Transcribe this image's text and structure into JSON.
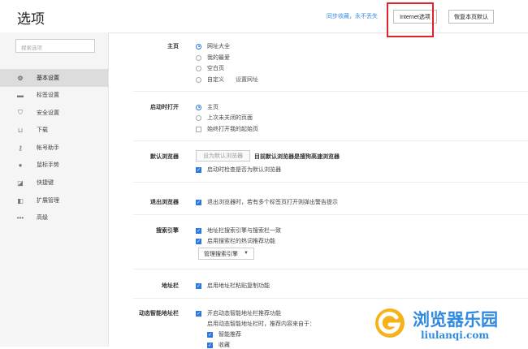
{
  "header": {
    "title": "选项",
    "sync_link": "同步收藏，永不丢失",
    "internet_options_label": "Internet选项",
    "restore_default_label": "恢复本页默认"
  },
  "sidebar": {
    "search_placeholder": "搜索选项",
    "items": [
      {
        "label": "基本设置",
        "icon": "gear-icon",
        "active": true
      },
      {
        "label": "标签设置",
        "icon": "tab-icon"
      },
      {
        "label": "安全设置",
        "icon": "shield-icon"
      },
      {
        "label": "下载",
        "icon": "download-icon"
      },
      {
        "label": "帐号助手",
        "icon": "key-icon"
      },
      {
        "label": "鼠标手势",
        "icon": "mouse-icon"
      },
      {
        "label": "快捷键",
        "icon": "shortcut-icon"
      },
      {
        "label": "扩展管理",
        "icon": "extension-icon"
      },
      {
        "label": "高级",
        "icon": "more-icon"
      }
    ]
  },
  "sections": {
    "homepage": {
      "label": "主页",
      "options": [
        "网址大全",
        "我的最爱",
        "空白页",
        "自定义"
      ],
      "selected": 0,
      "set_url_link": "设置网址"
    },
    "startup": {
      "label": "启动时打开",
      "options": [
        "主页",
        "上次未关闭的页面"
      ],
      "selected": 0,
      "always_open_checkbox": "始终打开我的起始页"
    },
    "default_browser": {
      "label": "默认浏览器",
      "set_default_button": "设为默认浏览器",
      "status_text": "目前默认浏览器是搜狗高速浏览器",
      "check_on_startup": "启动时检查是否为默认浏览器"
    },
    "exit_browser": {
      "label": "退出浏览器",
      "warn_checkbox": "退出浏览器时，若有多个标签页打开则弹出警告提示"
    },
    "search_engine": {
      "label": "搜索引擎",
      "sync_engine": "地址栏搜索引擎与搜索栏一致",
      "hot_words": "启用搜索栏的热词推荐功能",
      "manage_dropdown": "管理搜索引擎"
    },
    "address_bar": {
      "label": "地址栏",
      "paste_copy": "启用地址栏粘贴复制功能"
    },
    "smart_address_bar": {
      "label": "动态智能地址栏",
      "enable": "开启动态智能地址栏推荐功能",
      "desc": "启用动态智能地址栏时，推荐内容来自于：",
      "sub_options": [
        "智能推荐",
        "收藏"
      ]
    }
  },
  "watermark": {
    "cn": "浏览器乐园",
    "en": "liulanqi.com"
  },
  "colors": {
    "accent": "#2a7ae2",
    "highlight_box": "#e0232a",
    "watermark": "#2f8ae0"
  }
}
